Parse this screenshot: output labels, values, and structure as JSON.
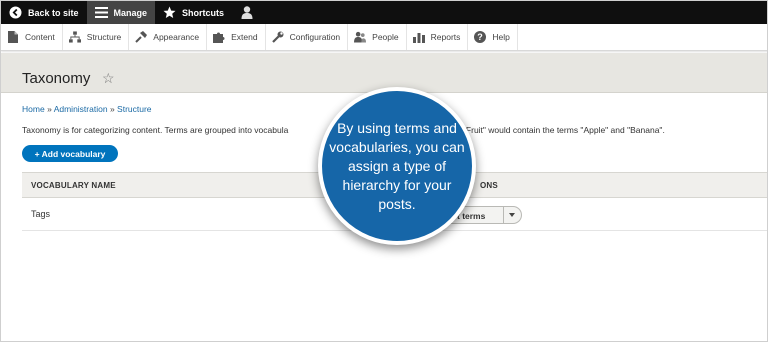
{
  "toolbar": {
    "back_label": "Back to site",
    "manage_label": "Manage",
    "shortcuts_label": "Shortcuts"
  },
  "tray": {
    "items": [
      {
        "label": "Content",
        "icon": "content-icon"
      },
      {
        "label": "Structure",
        "icon": "structure-icon"
      },
      {
        "label": "Appearance",
        "icon": "appearance-icon"
      },
      {
        "label": "Extend",
        "icon": "extend-icon"
      },
      {
        "label": "Configuration",
        "icon": "configuration-icon"
      },
      {
        "label": "People",
        "icon": "people-icon"
      },
      {
        "label": "Reports",
        "icon": "reports-icon"
      },
      {
        "label": "Help",
        "icon": "help-icon"
      }
    ]
  },
  "page": {
    "title": "Taxonomy",
    "breadcrumb": [
      "Home",
      "Administration",
      "Structure"
    ],
    "breadcrumb_sep": "»",
    "description": "Taxonomy is for categorizing content. Terms are grouped into vocabula",
    "description_tail": "called \"Fruit\" would contain the terms \"Apple\" and \"Banana\".",
    "add_button": "+ Add vocabulary"
  },
  "table": {
    "columns": [
      "VOCABULARY NAME",
      "ONS"
    ],
    "rows": [
      {
        "name": "Tags",
        "operation": "t terms"
      }
    ]
  },
  "callout": {
    "text": "By using terms and vocabularies, you can assign a type of hierarchy for your posts."
  },
  "colors": {
    "accent": "#0074bd",
    "callout": "#1666a8",
    "toolbar": "#0f0f0f"
  }
}
